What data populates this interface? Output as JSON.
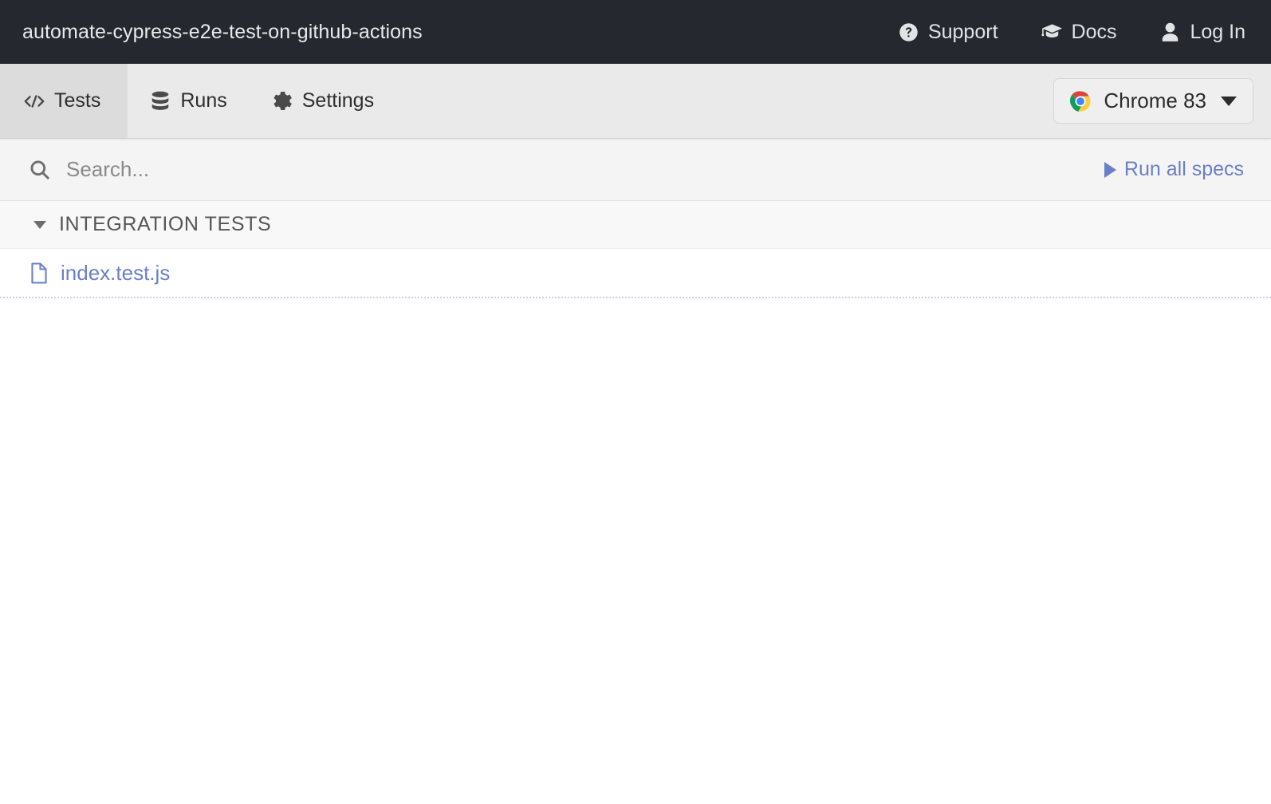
{
  "header": {
    "project_title": "automate-cypress-e2e-test-on-github-actions",
    "background_color": "#25282f",
    "links": [
      {
        "label": "Support",
        "icon": "question-circle-icon"
      },
      {
        "label": "Docs",
        "icon": "graduation-cap-icon"
      },
      {
        "label": "Log In",
        "icon": "user-icon"
      }
    ]
  },
  "tabs": [
    {
      "label": "Tests",
      "icon": "code-icon",
      "active": true
    },
    {
      "label": "Runs",
      "icon": "database-icon",
      "active": false
    },
    {
      "label": "Settings",
      "icon": "gear-icon",
      "active": false
    }
  ],
  "browser_selector": {
    "label": "Chrome 83",
    "icon": "chrome-logo-icon",
    "caret": "chevron-down-icon"
  },
  "search": {
    "placeholder": "Search...",
    "value": "",
    "icon": "search-icon"
  },
  "run_all": {
    "label": "Run all specs",
    "icon": "play-icon",
    "color": "#6b7fc7"
  },
  "spec_list": {
    "folders": [
      {
        "label": "INTEGRATION TESTS",
        "expanded": true,
        "caret": "caret-down-icon",
        "specs": [
          {
            "name": "index.test.js",
            "icon": "file-icon"
          }
        ]
      }
    ]
  }
}
